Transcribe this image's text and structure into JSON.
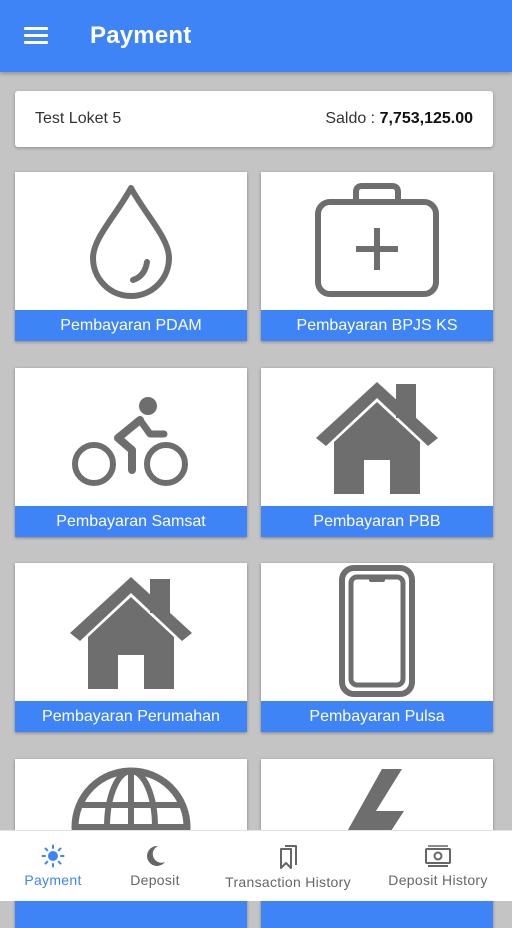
{
  "appbar": {
    "title": "Payment",
    "menu_icon": "hamburger-menu-icon"
  },
  "account": {
    "name": "Test Loket 5",
    "saldo_label": "Saldo : ",
    "saldo_value": "7,753,125.00"
  },
  "tiles": [
    {
      "label": "Pembayaran PDAM",
      "icon": "water-drop-icon"
    },
    {
      "label": "Pembayaran BPJS KS",
      "icon": "medical-kit-icon"
    },
    {
      "label": "Pembayaran Samsat",
      "icon": "bicycle-rider-icon"
    },
    {
      "label": "Pembayaran PBB",
      "icon": "house-icon"
    },
    {
      "label": "Pembayaran Perumahan",
      "icon": "house-icon"
    },
    {
      "label": "Pembayaran Pulsa",
      "icon": "smartphone-icon"
    },
    {
      "label": "",
      "icon": "globe-icon"
    },
    {
      "label": "",
      "icon": "lightning-icon"
    }
  ],
  "bottom_nav": [
    {
      "label": "Payment",
      "icon": "sun-icon",
      "active": true
    },
    {
      "label": "Deposit",
      "icon": "moon-icon",
      "active": false
    },
    {
      "label": "Transaction History",
      "icon": "bookmarks-icon",
      "active": false
    },
    {
      "label": "Deposit History",
      "icon": "money-icon",
      "active": false
    }
  ],
  "colors": {
    "primary": "#3f84f6",
    "icon_gray": "#6e6e6e",
    "background": "#c4c4c4"
  }
}
